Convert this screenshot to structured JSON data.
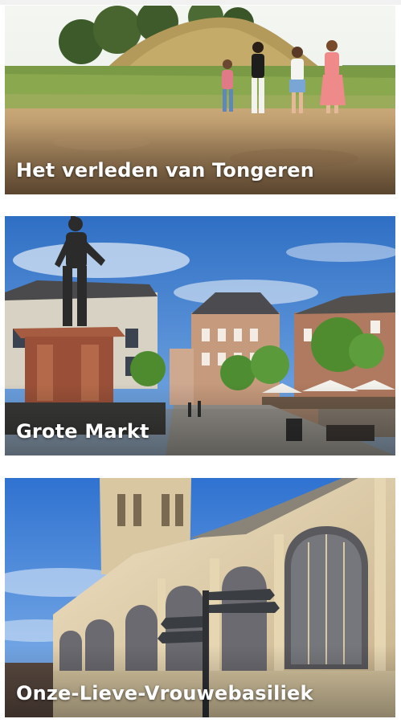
{
  "cards": [
    {
      "title": "Het verleden van Tongeren",
      "image": "tumulus-walkers-photo"
    },
    {
      "title": "Grote Markt",
      "image": "ambiorix-statue-square-photo"
    },
    {
      "title": "Onze-Lieve-Vrouwebasiliek",
      "image": "basilica-signpost-photo"
    }
  ],
  "colors": {
    "title_text": "#ffffff",
    "page_background": "#ffffff"
  }
}
